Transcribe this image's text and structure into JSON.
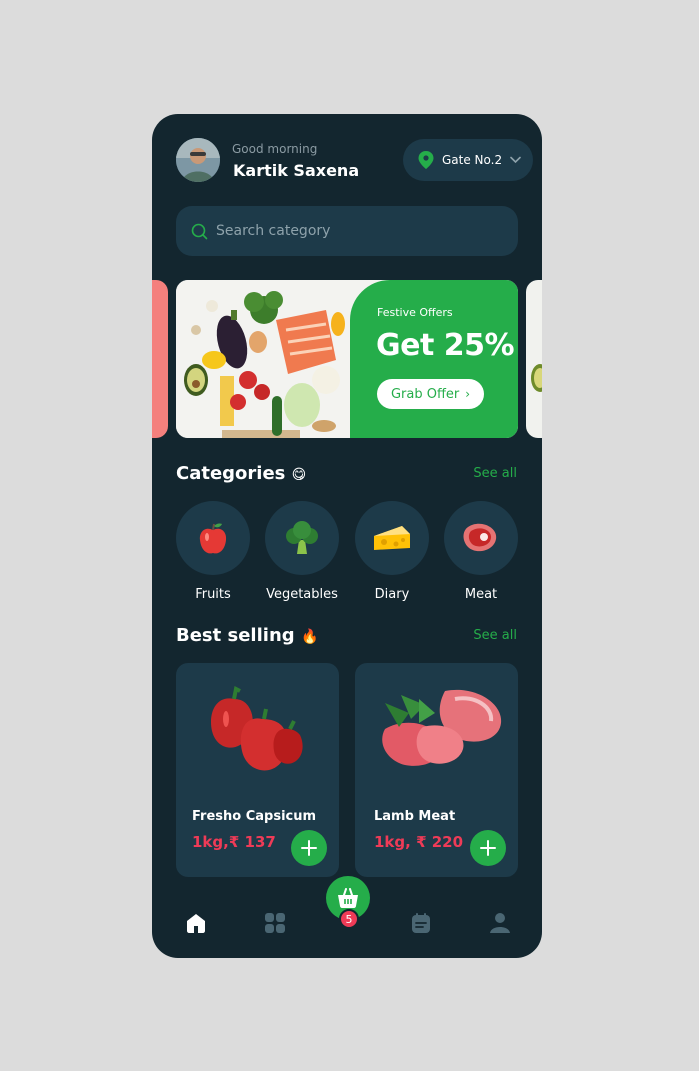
{
  "header": {
    "greeting": "Good morning",
    "user_name": "Kartik Saxena",
    "location": "Gate No.2"
  },
  "search": {
    "placeholder": "Search category",
    "icon": "search-icon"
  },
  "banner": {
    "eyebrow": "Festive Offers",
    "title": "Get 25%",
    "button_label": "Grab Offer",
    "button_arrow": "›"
  },
  "categories": {
    "title": "Categories",
    "emoji": "😋",
    "see_all": "See all",
    "items": [
      {
        "label": "Fruits",
        "icon": "apple-icon"
      },
      {
        "label": "Vegetables",
        "icon": "broccoli-icon"
      },
      {
        "label": "Diary",
        "icon": "cheese-icon"
      },
      {
        "label": "Meat",
        "icon": "meat-icon"
      }
    ]
  },
  "best_selling": {
    "title": "Best selling",
    "emoji": "🔥",
    "see_all": "See all",
    "products": [
      {
        "name": "Fresho Capsicum",
        "price": "1kg,₹ 137"
      },
      {
        "name": "Lamb Meat",
        "price": "1kg, ₹ 220"
      }
    ]
  },
  "bottom_nav": {
    "cart_count": "5",
    "items": [
      "home-icon",
      "grid-icon",
      "cart-icon",
      "calendar-icon",
      "profile-icon"
    ]
  },
  "colors": {
    "background": "#13262f",
    "surface": "#1d3a49",
    "accent": "#25ad4a",
    "price": "#ef3b57"
  }
}
